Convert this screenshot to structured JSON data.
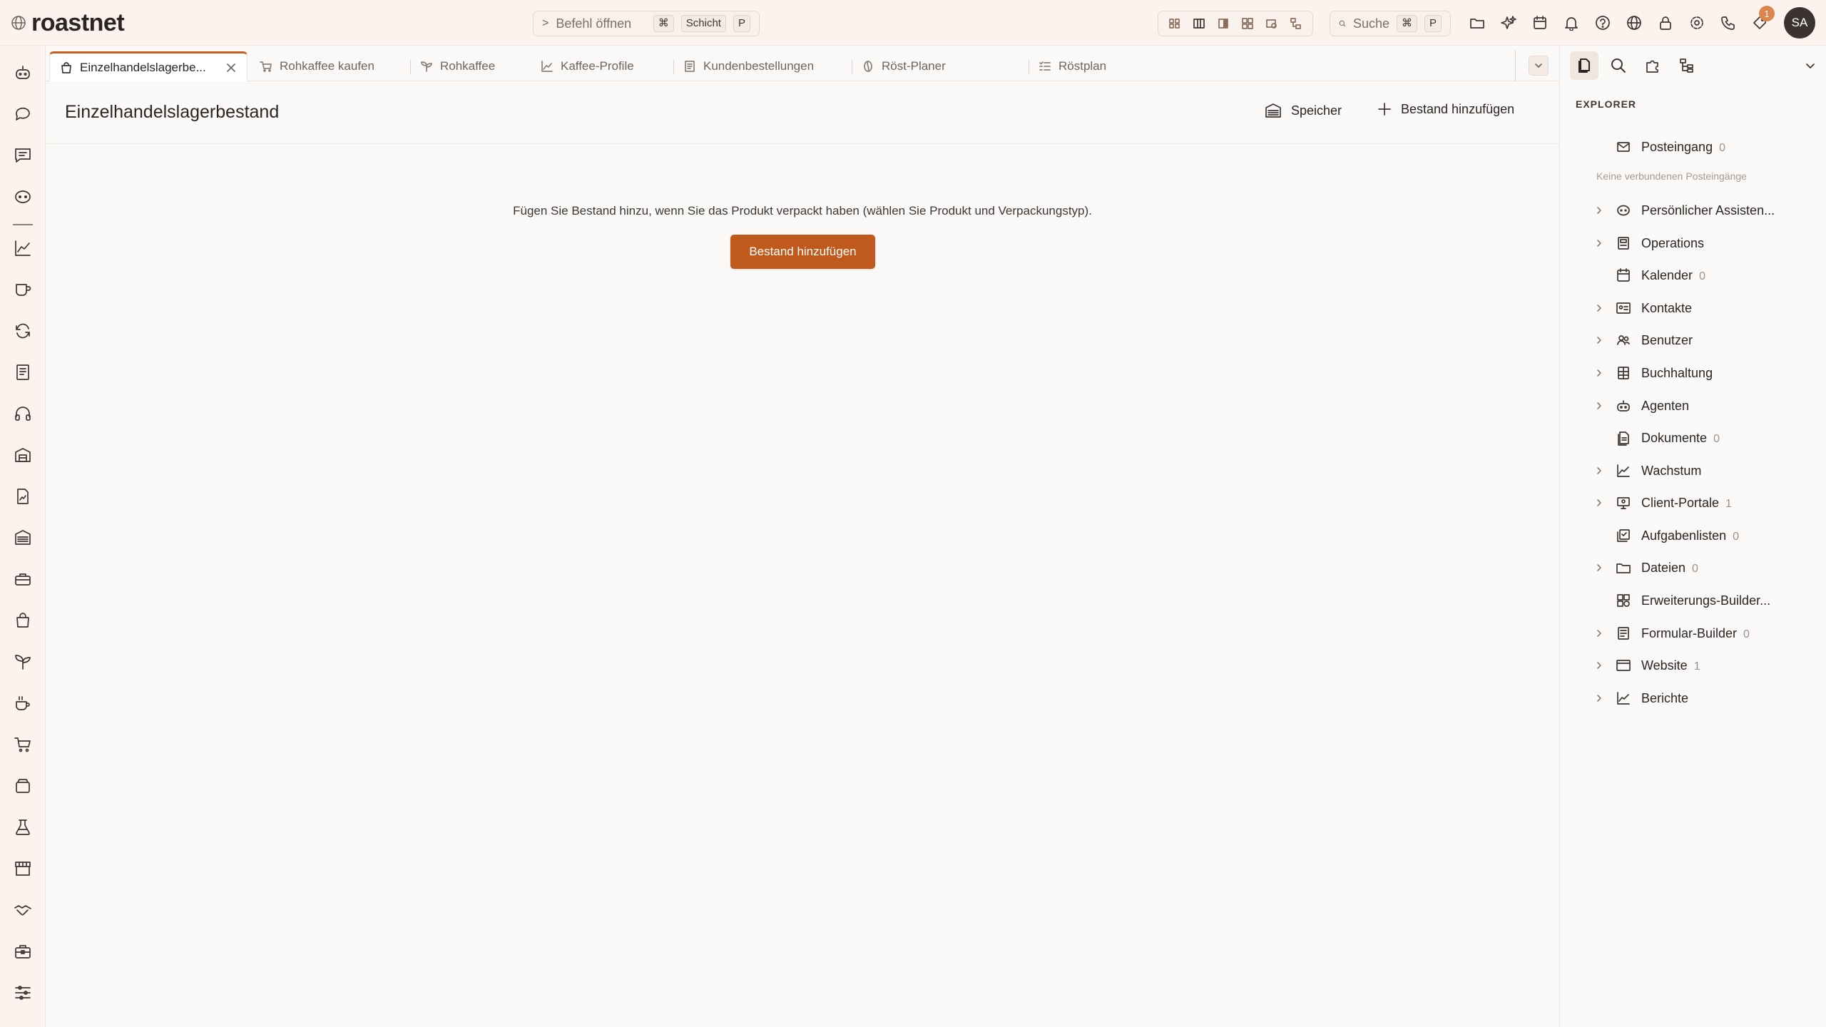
{
  "app": {
    "logo_text": "roastnet",
    "command_placeholder": "Befehl öffnen",
    "command_keys": [
      "⌘",
      "Schicht",
      "P"
    ],
    "search_label": "Suche",
    "search_keys": [
      "⌘",
      "P"
    ],
    "notification_count": "1",
    "user_initials": "SA"
  },
  "layout_buttons": [
    "grid-layout-icon",
    "columns-layout-icon",
    "sidebar-layout-icon",
    "tiles-layout-icon",
    "folder-search-icon",
    "tree-layout-icon"
  ],
  "top_icons": [
    "folder-icon",
    "sparkle-icon",
    "calendar-icon",
    "bell-icon",
    "help-icon",
    "globe-icon",
    "lock-icon",
    "gear-icon",
    "phone-icon",
    "tag-icon"
  ],
  "rail_icons": [
    "robot-icon",
    "chat-bubble-icon",
    "message-icon",
    "assistant-icon",
    "chart-icon",
    "coffee-cup-icon",
    "refresh-icon",
    "document-icon",
    "headphones-icon",
    "warehouse-icon",
    "file-chart-icon",
    "storage-icon",
    "toolbox-icon",
    "shopping-bag-icon",
    "sprout-icon",
    "hot-coffee-icon",
    "cart-icon",
    "package-icon",
    "flask-icon",
    "store-icon",
    "handshake-icon",
    "briefcase-icon",
    "sliders-icon"
  ],
  "tabs": [
    {
      "label": "Einzelhandelslagerbe...",
      "icon": "bag-icon"
    },
    {
      "label": "Rohkaffee kaufen",
      "icon": "cart-icon"
    },
    {
      "label": "Rohkaffee",
      "icon": "sprout-icon"
    },
    {
      "label": "Kaffee-Profile",
      "icon": "chart-icon"
    },
    {
      "label": "Kundenbestellungen",
      "icon": "list-icon"
    },
    {
      "label": "Röst-Planer",
      "icon": "bean-icon"
    },
    {
      "label": "Röstplan",
      "icon": "checklist-icon"
    }
  ],
  "main": {
    "title": "Einzelhandelslagerbestand",
    "storage_button": "Speicher",
    "add_stock_header_button": "Bestand hinzufügen",
    "empty_message": "Fügen Sie Bestand hinzu, wenn Sie das Produkt verpackt haben (wählen Sie Produkt und Verpackungstyp).",
    "add_stock_button": "Bestand hinzufügen"
  },
  "explorer": {
    "title": "EXPLORER",
    "inbox_note": "Keine verbundenen Posteingänge",
    "items": [
      {
        "label": "Posteingang",
        "count": "0",
        "chevron": false,
        "icon": "mail-icon"
      },
      {
        "label": "Persönlicher Assisten...",
        "count": "",
        "chevron": true,
        "icon": "assistant-icon"
      },
      {
        "label": "Operations",
        "count": "",
        "chevron": true,
        "icon": "register-icon"
      },
      {
        "label": "Kalender",
        "count": "0",
        "chevron": false,
        "icon": "calendar-icon"
      },
      {
        "label": "Kontakte",
        "count": "",
        "chevron": true,
        "icon": "contact-card-icon"
      },
      {
        "label": "Benutzer",
        "count": "",
        "chevron": true,
        "icon": "users-icon"
      },
      {
        "label": "Buchhaltung",
        "count": "",
        "chevron": true,
        "icon": "ledger-icon"
      },
      {
        "label": "Agenten",
        "count": "",
        "chevron": true,
        "icon": "robot-icon"
      },
      {
        "label": "Dokumente",
        "count": "0",
        "chevron": false,
        "icon": "documents-icon"
      },
      {
        "label": "Wachstum",
        "count": "",
        "chevron": true,
        "icon": "chart-icon"
      },
      {
        "label": "Client-Portale",
        "count": "1",
        "chevron": true,
        "icon": "portal-icon"
      },
      {
        "label": "Aufgabenlisten",
        "count": "0",
        "chevron": false,
        "icon": "tasklist-icon"
      },
      {
        "label": "Dateien",
        "count": "0",
        "chevron": true,
        "icon": "folder-icon"
      },
      {
        "label": "Erweiterungs-Builder...",
        "count": "",
        "chevron": false,
        "icon": "extension-icon"
      },
      {
        "label": "Formular-Builder",
        "count": "0",
        "chevron": true,
        "icon": "form-icon"
      },
      {
        "label": "Website",
        "count": "1",
        "chevron": true,
        "icon": "browser-icon"
      },
      {
        "label": "Berichte",
        "count": "",
        "chevron": true,
        "icon": "report-chart-icon"
      }
    ]
  },
  "colors": {
    "accent": "#c0591c",
    "tab_accent": "#c85f1e",
    "topbar_bg": "#fcf3ee",
    "badge": "#d9874e"
  }
}
